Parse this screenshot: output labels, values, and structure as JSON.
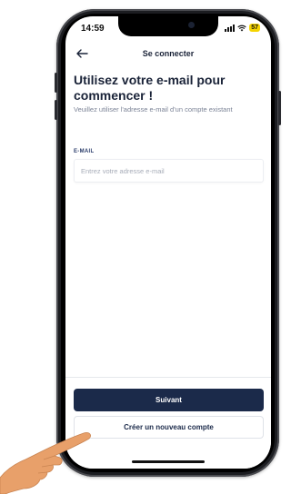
{
  "status_bar": {
    "time": "14:59",
    "battery": "57",
    "icons": [
      "signal-icon",
      "wifi-icon",
      "battery-icon"
    ]
  },
  "nav": {
    "back_icon": "back-arrow-icon",
    "title": "Se connecter"
  },
  "content": {
    "title": "Utilisez votre e-mail pour commencer !",
    "subtitle": "Veuillez utiliser l'adresse e-mail d'un compte existant",
    "email_label": "E-MAIL",
    "email_placeholder": "Entrez votre adresse e-mail",
    "email_value": ""
  },
  "actions": {
    "next_label": "Suivant",
    "create_account_label": "Créer un nouveau compte"
  },
  "colors": {
    "primary": "#1b2a4a",
    "battery": "#f5d400",
    "skin": "#e8a06a"
  }
}
